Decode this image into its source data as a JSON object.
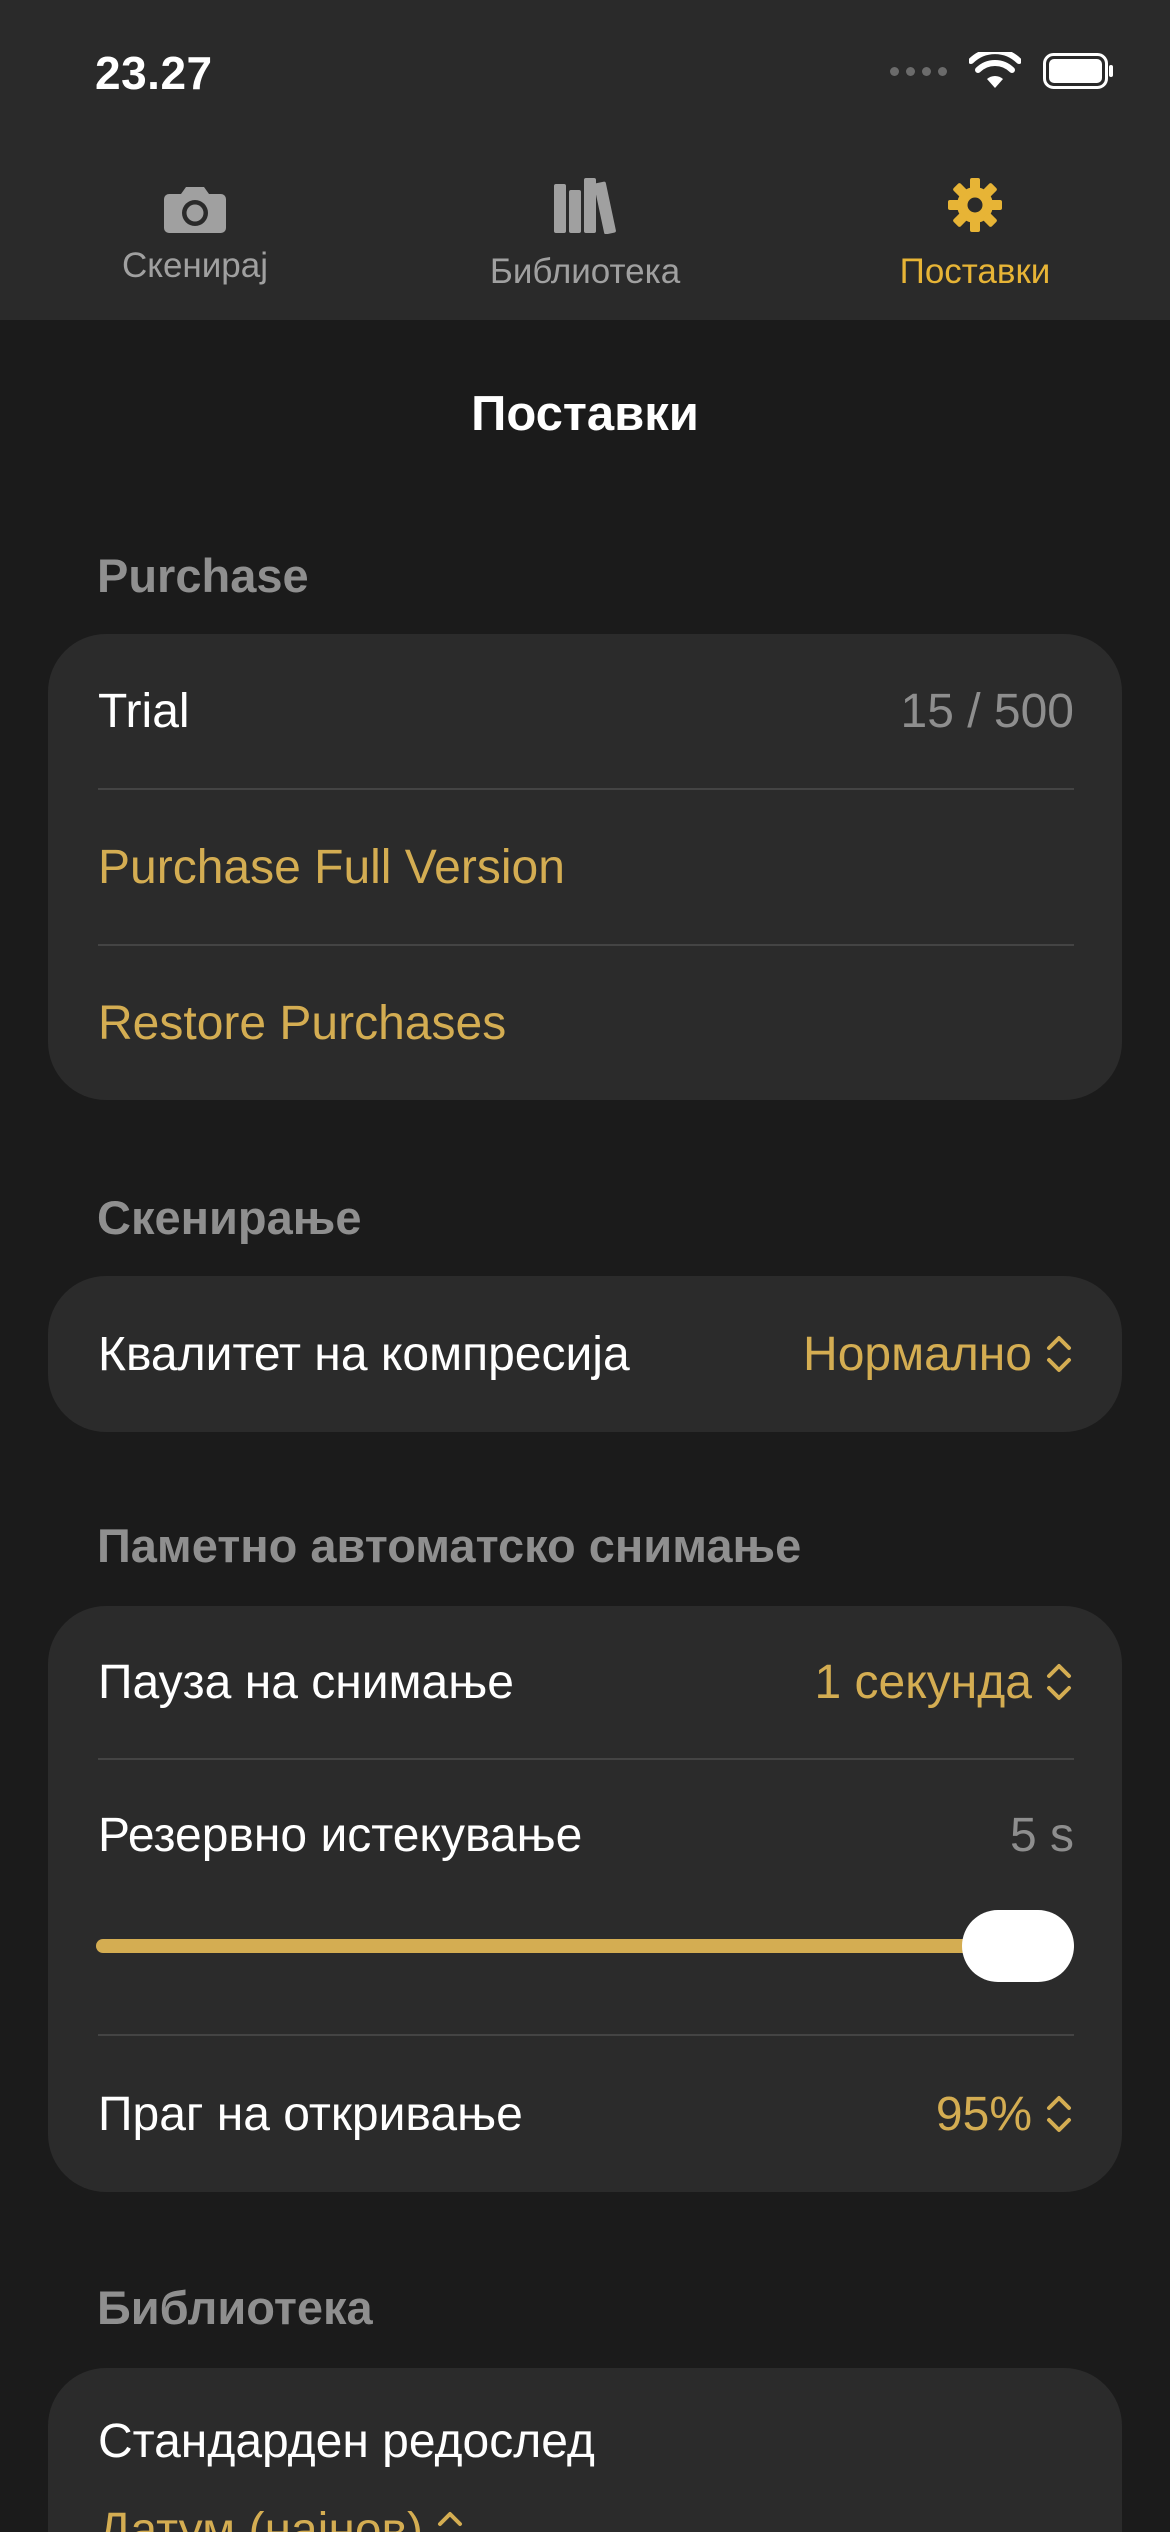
{
  "status_bar": {
    "time": "23.27"
  },
  "tabs": [
    {
      "label": "Скенирај",
      "icon": "camera-icon",
      "active": false
    },
    {
      "label": "Библиотека",
      "icon": "books-icon",
      "active": false
    },
    {
      "label": "Поставки",
      "icon": "gear-icon",
      "active": true
    }
  ],
  "page_title": "Поставки",
  "purchase": {
    "header": "Purchase",
    "trial_label": "Trial",
    "trial_value": "15 / 500",
    "buy_label": "Purchase Full Version",
    "restore_label": "Restore Purchases"
  },
  "scanning": {
    "header": "Скенирање",
    "compression_label": "Квалитет на компресија",
    "compression_value": "Нормално"
  },
  "auto_capture": {
    "header": "Паметно автоматско снимање",
    "pause_label": "Пауза на снимање",
    "pause_value": "1 секунда",
    "timeout_label": "Резервно истекување",
    "timeout_value": "5 s",
    "timeout_slider_fraction": 1.0,
    "threshold_label": "Праг на откривање",
    "threshold_value": "95%"
  },
  "library": {
    "header": "Библиотека",
    "sort_label": "Стандарден редослед",
    "sort_value": "Датум (најнов)"
  },
  "colors": {
    "accent": "#e7b436",
    "accent_text": "#d4ad52",
    "background": "#1b1b1b",
    "card": "#2b2b2b",
    "secondary_text": "#8e8e8e"
  }
}
